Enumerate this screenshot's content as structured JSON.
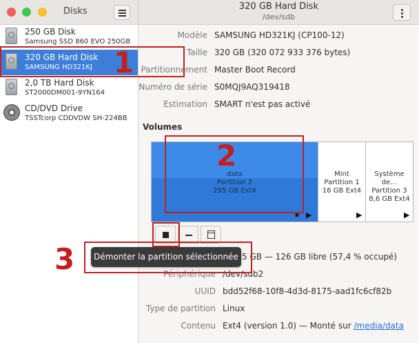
{
  "window": {
    "app_title": "Disks",
    "disk_title": "320 GB Hard Disk",
    "disk_path": "/dev/sdb"
  },
  "drives": [
    {
      "name": "250 GB Disk",
      "model": "Samsung SSD 860 EVO 250GB",
      "icon": "hard-disk-icon",
      "selected": false
    },
    {
      "name": "320 GB Hard Disk",
      "model": "SAMSUNG HD321KJ",
      "icon": "hard-disk-icon",
      "selected": true
    },
    {
      "name": "2,0 TB Hard Disk",
      "model": "ST2000DM001-9YN164",
      "icon": "hard-disk-icon",
      "selected": false
    },
    {
      "name": "CD/DVD Drive",
      "model": "TSSTcorp CDDVDW SH-224BB",
      "icon": "optical-disc-icon",
      "selected": false
    }
  ],
  "disk_info": [
    {
      "label": "Modèle",
      "value": "SAMSUNG HD321KJ (CP100-12)"
    },
    {
      "label": "Taille",
      "value": "320 GB (320 072 933 376 bytes)"
    },
    {
      "label": "Partitionnement",
      "value": "Master Boot Record"
    },
    {
      "label": "Numéro de série",
      "value": "S0MQJ9AQ319418"
    },
    {
      "label": "Estimation",
      "value": "SMART n'est pas activé"
    }
  ],
  "volumes": {
    "title": "Volumes",
    "partitions": [
      {
        "name": "data",
        "label": "Partition 2",
        "size": "295 GB Ext4",
        "selected": true
      },
      {
        "name": "Mint",
        "label": "Partition 1",
        "size": "16 GB Ext4",
        "selected": false
      },
      {
        "name": "Système de…",
        "label": "Partition 3",
        "size": "8,6 GB Ext4",
        "selected": false
      }
    ]
  },
  "toolbar": {
    "unmount_icon": "stop-icon",
    "delete_icon": "minus-icon",
    "more_icon": "partition-options-icon",
    "tooltip": "Démonter la partition sélectionnée"
  },
  "partition_info": {
    "size_value_partial": "5 GB — 126 GB libre (57,4 % occupé)",
    "device_label": "Périphérique",
    "device_value": "/dev/sdb2",
    "uuid_label": "UUID",
    "uuid_value": "bdd52f68-10f8-4d3d-8175-aad1fc6cf82b",
    "type_label": "Type de partition",
    "type_value": "Linux",
    "content_label": "Contenu",
    "content_value": "Ext4 (version 1.0) — Monté sur ",
    "content_link": "/media/data"
  },
  "callouts": [
    "1",
    "2",
    "3"
  ],
  "colors": {
    "selection": "#3d7ed8",
    "callout": "#c0201f",
    "partition_selected": "#3e8ae8"
  }
}
